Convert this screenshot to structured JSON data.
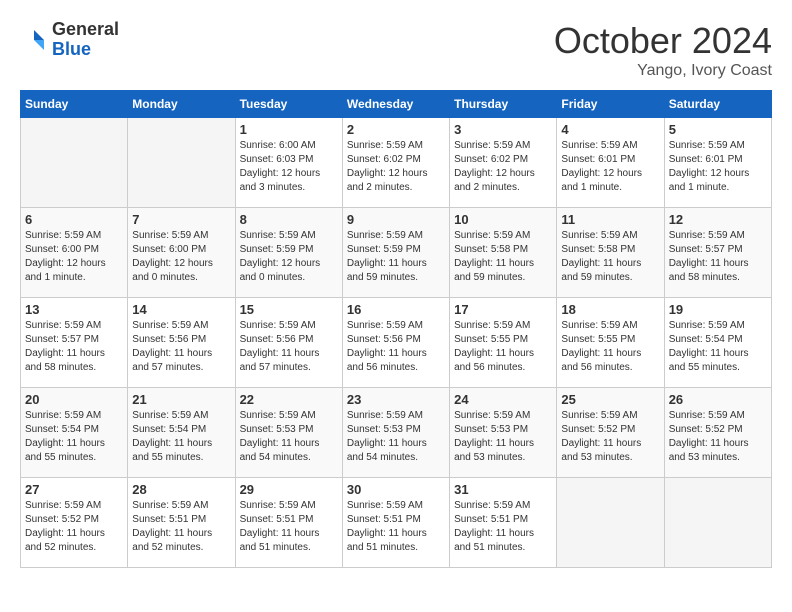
{
  "logo": {
    "general": "General",
    "blue": "Blue"
  },
  "title": "October 2024",
  "subtitle": "Yango, Ivory Coast",
  "days_header": [
    "Sunday",
    "Monday",
    "Tuesday",
    "Wednesday",
    "Thursday",
    "Friday",
    "Saturday"
  ],
  "weeks": [
    [
      {
        "day": "",
        "info": ""
      },
      {
        "day": "",
        "info": ""
      },
      {
        "day": "1",
        "info": "Sunrise: 6:00 AM\nSunset: 6:03 PM\nDaylight: 12 hours and 3 minutes."
      },
      {
        "day": "2",
        "info": "Sunrise: 5:59 AM\nSunset: 6:02 PM\nDaylight: 12 hours and 2 minutes."
      },
      {
        "day": "3",
        "info": "Sunrise: 5:59 AM\nSunset: 6:02 PM\nDaylight: 12 hours and 2 minutes."
      },
      {
        "day": "4",
        "info": "Sunrise: 5:59 AM\nSunset: 6:01 PM\nDaylight: 12 hours and 1 minute."
      },
      {
        "day": "5",
        "info": "Sunrise: 5:59 AM\nSunset: 6:01 PM\nDaylight: 12 hours and 1 minute."
      }
    ],
    [
      {
        "day": "6",
        "info": "Sunrise: 5:59 AM\nSunset: 6:00 PM\nDaylight: 12 hours and 1 minute."
      },
      {
        "day": "7",
        "info": "Sunrise: 5:59 AM\nSunset: 6:00 PM\nDaylight: 12 hours and 0 minutes."
      },
      {
        "day": "8",
        "info": "Sunrise: 5:59 AM\nSunset: 5:59 PM\nDaylight: 12 hours and 0 minutes."
      },
      {
        "day": "9",
        "info": "Sunrise: 5:59 AM\nSunset: 5:59 PM\nDaylight: 11 hours and 59 minutes."
      },
      {
        "day": "10",
        "info": "Sunrise: 5:59 AM\nSunset: 5:58 PM\nDaylight: 11 hours and 59 minutes."
      },
      {
        "day": "11",
        "info": "Sunrise: 5:59 AM\nSunset: 5:58 PM\nDaylight: 11 hours and 59 minutes."
      },
      {
        "day": "12",
        "info": "Sunrise: 5:59 AM\nSunset: 5:57 PM\nDaylight: 11 hours and 58 minutes."
      }
    ],
    [
      {
        "day": "13",
        "info": "Sunrise: 5:59 AM\nSunset: 5:57 PM\nDaylight: 11 hours and 58 minutes."
      },
      {
        "day": "14",
        "info": "Sunrise: 5:59 AM\nSunset: 5:56 PM\nDaylight: 11 hours and 57 minutes."
      },
      {
        "day": "15",
        "info": "Sunrise: 5:59 AM\nSunset: 5:56 PM\nDaylight: 11 hours and 57 minutes."
      },
      {
        "day": "16",
        "info": "Sunrise: 5:59 AM\nSunset: 5:56 PM\nDaylight: 11 hours and 56 minutes."
      },
      {
        "day": "17",
        "info": "Sunrise: 5:59 AM\nSunset: 5:55 PM\nDaylight: 11 hours and 56 minutes."
      },
      {
        "day": "18",
        "info": "Sunrise: 5:59 AM\nSunset: 5:55 PM\nDaylight: 11 hours and 56 minutes."
      },
      {
        "day": "19",
        "info": "Sunrise: 5:59 AM\nSunset: 5:54 PM\nDaylight: 11 hours and 55 minutes."
      }
    ],
    [
      {
        "day": "20",
        "info": "Sunrise: 5:59 AM\nSunset: 5:54 PM\nDaylight: 11 hours and 55 minutes."
      },
      {
        "day": "21",
        "info": "Sunrise: 5:59 AM\nSunset: 5:54 PM\nDaylight: 11 hours and 55 minutes."
      },
      {
        "day": "22",
        "info": "Sunrise: 5:59 AM\nSunset: 5:53 PM\nDaylight: 11 hours and 54 minutes."
      },
      {
        "day": "23",
        "info": "Sunrise: 5:59 AM\nSunset: 5:53 PM\nDaylight: 11 hours and 54 minutes."
      },
      {
        "day": "24",
        "info": "Sunrise: 5:59 AM\nSunset: 5:53 PM\nDaylight: 11 hours and 53 minutes."
      },
      {
        "day": "25",
        "info": "Sunrise: 5:59 AM\nSunset: 5:52 PM\nDaylight: 11 hours and 53 minutes."
      },
      {
        "day": "26",
        "info": "Sunrise: 5:59 AM\nSunset: 5:52 PM\nDaylight: 11 hours and 53 minutes."
      }
    ],
    [
      {
        "day": "27",
        "info": "Sunrise: 5:59 AM\nSunset: 5:52 PM\nDaylight: 11 hours and 52 minutes."
      },
      {
        "day": "28",
        "info": "Sunrise: 5:59 AM\nSunset: 5:51 PM\nDaylight: 11 hours and 52 minutes."
      },
      {
        "day": "29",
        "info": "Sunrise: 5:59 AM\nSunset: 5:51 PM\nDaylight: 11 hours and 51 minutes."
      },
      {
        "day": "30",
        "info": "Sunrise: 5:59 AM\nSunset: 5:51 PM\nDaylight: 11 hours and 51 minutes."
      },
      {
        "day": "31",
        "info": "Sunrise: 5:59 AM\nSunset: 5:51 PM\nDaylight: 11 hours and 51 minutes."
      },
      {
        "day": "",
        "info": ""
      },
      {
        "day": "",
        "info": ""
      }
    ]
  ]
}
